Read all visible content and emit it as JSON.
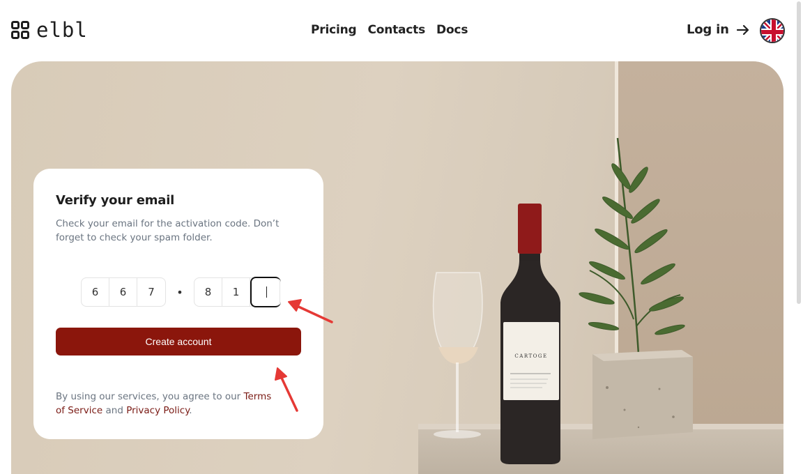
{
  "brand": {
    "name": "elbl"
  },
  "nav": {
    "items": [
      "Pricing",
      "Contacts",
      "Docs"
    ]
  },
  "header": {
    "login_label": "Log in",
    "language_icon": "uk-flag-icon"
  },
  "card": {
    "title": "Verify your email",
    "description": "Check your email for the activation code. Don’t forget to check your spam folder.",
    "code_digits": [
      "6",
      "6",
      "7",
      "8",
      "1",
      ""
    ],
    "separator": "•",
    "submit_label": "Create account",
    "legal_prefix": "By using our services, you agree to our",
    "terms_link": "Terms of Service",
    "legal_and": "and",
    "privacy_link": "Privacy Policy",
    "legal_suffix": "."
  },
  "bottle": {
    "label_text": "CARTOGE"
  },
  "colors": {
    "accent": "#8b160c",
    "link": "#7a1a14",
    "annotation": "#e53935"
  }
}
